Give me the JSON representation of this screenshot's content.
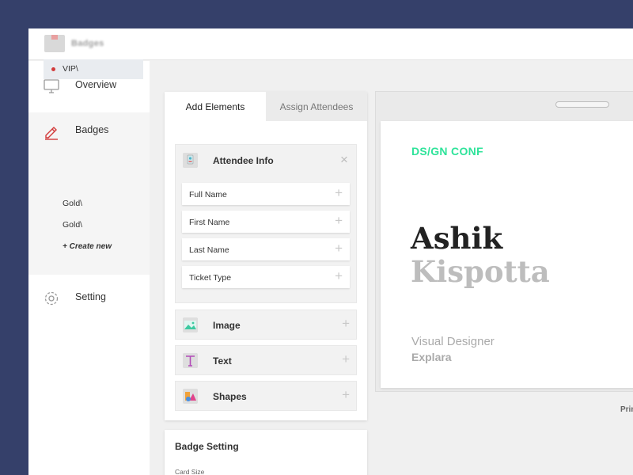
{
  "app": {
    "logo_text": "Badges"
  },
  "sidebar": {
    "overview_label": "Overview",
    "badges_label": "Badges",
    "badge_items": [
      "VIP\\",
      "Gold\\",
      "Gold\\"
    ],
    "create_label": "+ Create new",
    "setting_label": "Setting"
  },
  "panel": {
    "tabs": [
      "Add Elements",
      "Assign Attendees"
    ],
    "attendee_group": {
      "title": "Attendee Info",
      "fields": [
        "Full Name",
        "First Name",
        "Last Name",
        "Ticket Type"
      ]
    },
    "elements": [
      "Image",
      "Text",
      "Shapes"
    ]
  },
  "badge_setting": {
    "title": "Badge Setting",
    "card_size_label": "Card Size"
  },
  "badge": {
    "conference": "DS/GN CONF",
    "first_name": "Ashik",
    "last_name": "Kispotta",
    "role": "Visual Designer",
    "company": "Explara"
  },
  "print_label": "Prin",
  "colors": {
    "accent_green": "#2ee39a",
    "active_dot": "#d23b3b",
    "frame": "#35406a"
  }
}
